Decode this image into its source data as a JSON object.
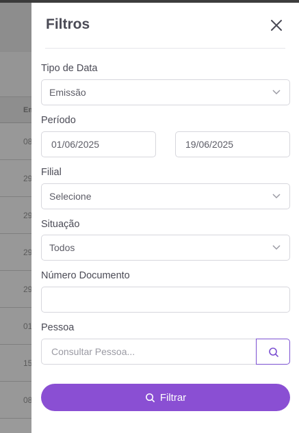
{
  "background": {
    "table_header": "Em",
    "rows": [
      "08",
      "29",
      "29",
      "29",
      "29",
      "01",
      "15",
      "08"
    ]
  },
  "drawer": {
    "title": "Filtros",
    "close_icon": "close-icon",
    "fields": {
      "tipo_data": {
        "label": "Tipo de Data",
        "value": "Emissão"
      },
      "periodo": {
        "label": "Período",
        "start": "01/06/2025",
        "end": "19/06/2025"
      },
      "filial": {
        "label": "Filial",
        "value": "Selecione"
      },
      "situacao": {
        "label": "Situação",
        "value": "Todos"
      },
      "numero_documento": {
        "label": "Número Documento",
        "value": ""
      },
      "pessoa": {
        "label": "Pessoa",
        "placeholder": "Consultar Pessoa..."
      }
    },
    "filter_button": {
      "label": "Filtrar"
    }
  },
  "colors": {
    "accent": "#8a4fd3",
    "text": "#4a4a55",
    "border": "#d6d6dc",
    "overlay": "#8a8a8a"
  }
}
